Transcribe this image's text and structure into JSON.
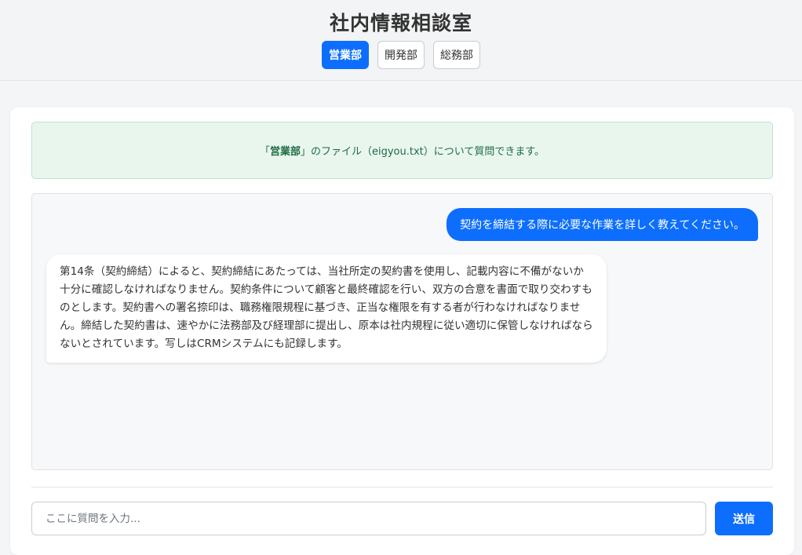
{
  "header": {
    "title": "社内情報相談室",
    "tabs": [
      {
        "label": "営業部",
        "active": true
      },
      {
        "label": "開発部",
        "active": false
      },
      {
        "label": "総務部",
        "active": false
      }
    ]
  },
  "notice": {
    "prefix": "「",
    "department": "営業部",
    "suffix": "」のファイル（eigyou.txt）について質問できます。"
  },
  "chat": {
    "user_message": "契約を締結する際に必要な作業を詳しく教えてください。",
    "bot_message": "第14条（契約締結）によると、契約締結にあたっては、当社所定の契約書を使用し、記載内容に不備がないか十分に確認しなければなりません。契約条件について顧客と最終確認を行い、双方の合意を書面で取り交わすものとします。契約書への署名捺印は、職務権限規程に基づき、正当な権限を有する者が行わなければなりません。締結した契約書は、速やかに法務部及び経理部に提出し、原本は社内規程に従い適切に保管しなければならないとされています。写しはCRMシステムにも記録します。"
  },
  "input": {
    "placeholder": "ここに質問を入力...",
    "value": ""
  },
  "send_label": "送信",
  "colors": {
    "accent": "#0d6efd",
    "notice_bg": "#e9f6ee",
    "notice_text": "#1f6b45"
  }
}
